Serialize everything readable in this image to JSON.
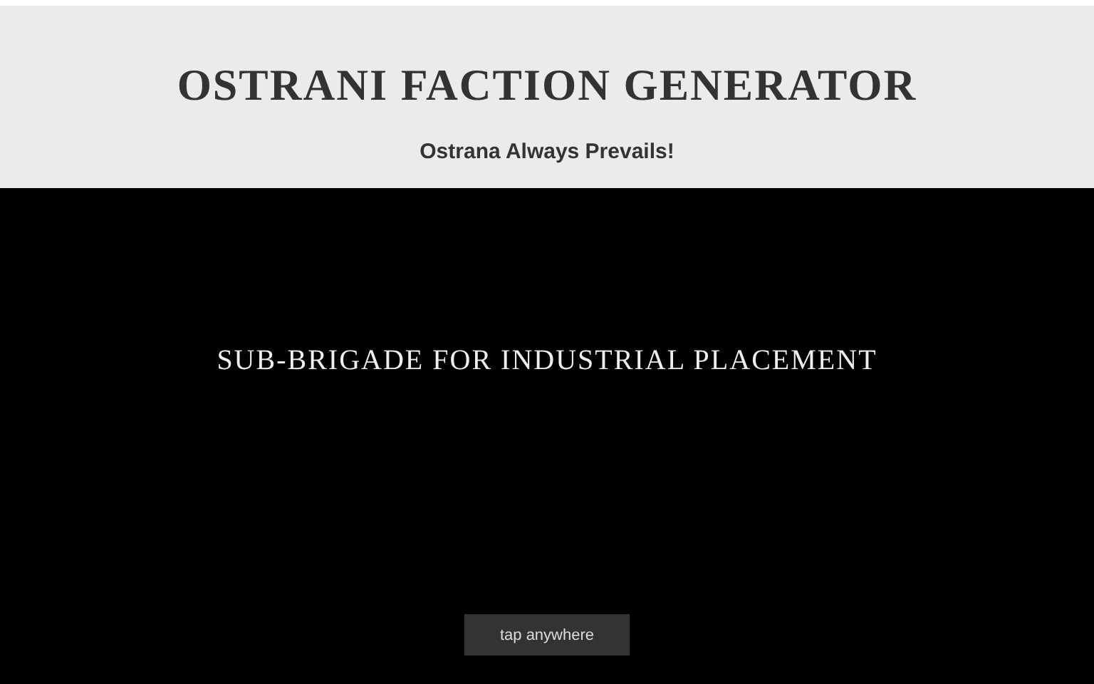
{
  "header": {
    "title": "OSTRANI FACTION GENERATOR",
    "subtitle": "Ostrana Always Prevails!"
  },
  "result": {
    "faction_name": "SUB-BRIGADE FOR INDUSTRIAL PLACEMENT"
  },
  "button": {
    "label": "tap anywhere"
  }
}
